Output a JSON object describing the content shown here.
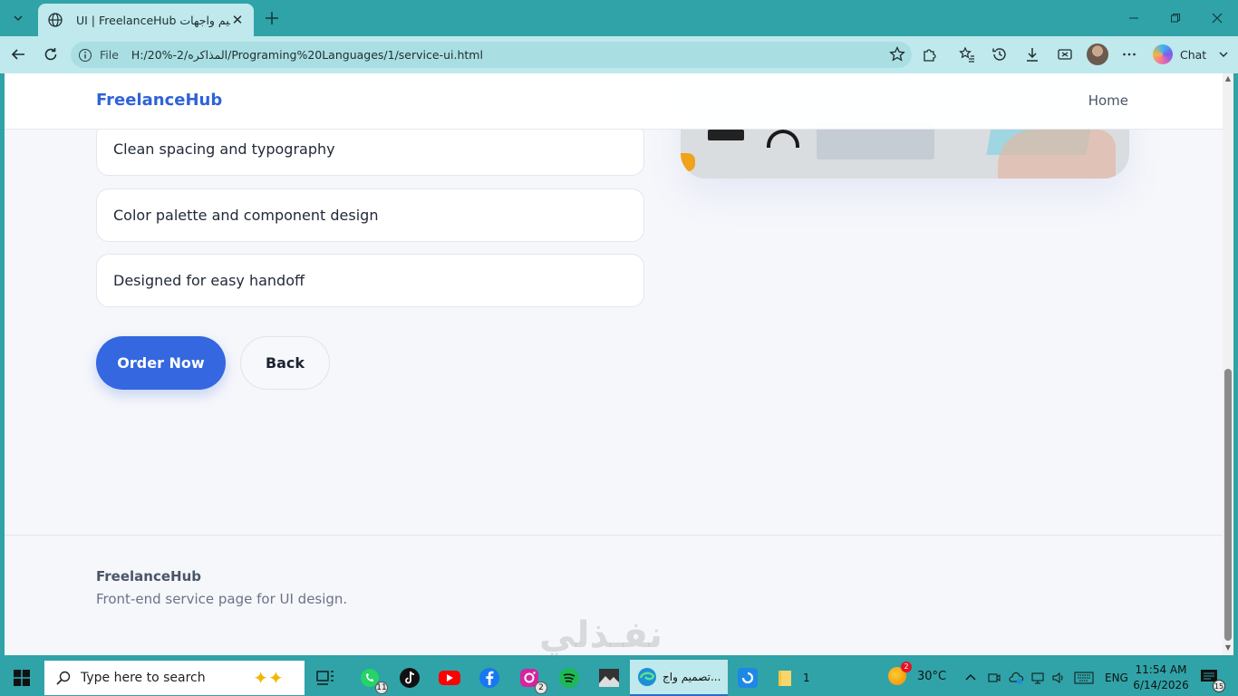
{
  "browser": {
    "tab_title": "UI | FreelanceHub تصميم واجهات",
    "address_file_label": "File",
    "address_url": "H:/20%-2/المذاكره/Programing%20Languages/1/service-ui.html",
    "chat_label": "Chat",
    "colors": {
      "chrome": "#2fa3a8",
      "toolbar": "#bfe9ec"
    }
  },
  "site": {
    "brand": "FreelanceHub",
    "nav": {
      "home": "Home"
    },
    "features": [
      {
        "label": "Clean spacing and typography"
      },
      {
        "label": "Color palette and component design"
      },
      {
        "label": "Designed for easy handoff"
      }
    ],
    "actions": {
      "order_label": "Order Now",
      "back_label": "Back"
    },
    "footer": {
      "brand": "FreelanceHub",
      "tagline": "Front-end service page for UI design."
    },
    "colors": {
      "accent": "#3467e0",
      "brand_text": "#2f63d7",
      "background": "#f6f7fb"
    }
  },
  "watermark": "نفـذلي",
  "taskbar": {
    "search_placeholder": "Type here to search",
    "whatsapp_badge": "11",
    "instagram_badge": "2",
    "edge_task_label": "تصميم واج...",
    "folder_task_label": "1",
    "weather_temp": "30°C",
    "weather_badge": "2",
    "language": "ENG",
    "time": "11:54 AM",
    "date": "6/14/2026",
    "notification_count": "15"
  }
}
